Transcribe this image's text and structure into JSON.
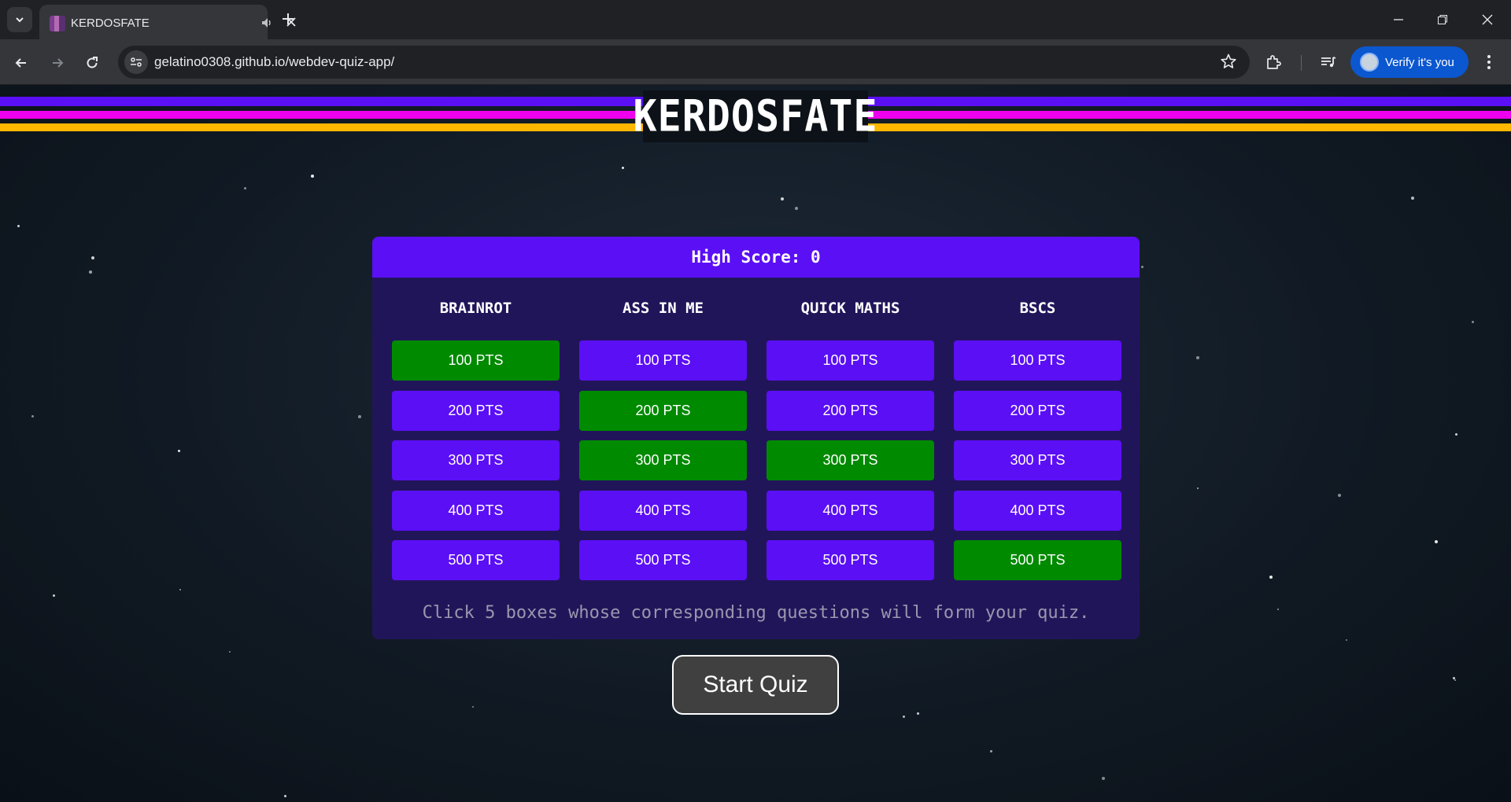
{
  "browser": {
    "tab_title": "KERDOSFATE",
    "url": "gelatino0308.github.io/webdev-quiz-app/",
    "profile_button": "Verify it's you",
    "icons": [
      "tab-search-icon",
      "audio-icon",
      "close-icon",
      "plus-icon",
      "minimize-icon",
      "restore-icon",
      "back-icon",
      "forward-icon",
      "reload-icon",
      "site-info-icon",
      "star-icon",
      "extensions-icon",
      "media-icon",
      "kebab-menu-icon"
    ]
  },
  "page": {
    "logo": "KERDOSFATE",
    "high_score_label": "High Score: 0",
    "colors": {
      "tile_default": "#5b0ff5",
      "tile_selected": "#008a00",
      "board_bg": "#21155a",
      "stripe_purple": "#5b0ff5",
      "stripe_magenta": "#ee00ee",
      "stripe_gold": "#ffb700"
    },
    "categories": [
      {
        "name": "BRAINROT",
        "tiles": [
          {
            "label": "100 PTS",
            "selected": true
          },
          {
            "label": "200 PTS",
            "selected": false
          },
          {
            "label": "300 PTS",
            "selected": false
          },
          {
            "label": "400 PTS",
            "selected": false
          },
          {
            "label": "500 PTS",
            "selected": false
          }
        ]
      },
      {
        "name": "ASS IN ME",
        "tiles": [
          {
            "label": "100 PTS",
            "selected": false
          },
          {
            "label": "200 PTS",
            "selected": true
          },
          {
            "label": "300 PTS",
            "selected": true
          },
          {
            "label": "400 PTS",
            "selected": false
          },
          {
            "label": "500 PTS",
            "selected": false
          }
        ]
      },
      {
        "name": "QUICK MATHS",
        "tiles": [
          {
            "label": "100 PTS",
            "selected": false
          },
          {
            "label": "200 PTS",
            "selected": false
          },
          {
            "label": "300 PTS",
            "selected": true
          },
          {
            "label": "400 PTS",
            "selected": false
          },
          {
            "label": "500 PTS",
            "selected": false
          }
        ]
      },
      {
        "name": "BSCS",
        "tiles": [
          {
            "label": "100 PTS",
            "selected": false
          },
          {
            "label": "200 PTS",
            "selected": false
          },
          {
            "label": "300 PTS",
            "selected": false
          },
          {
            "label": "400 PTS",
            "selected": false
          },
          {
            "label": "500 PTS",
            "selected": true
          }
        ]
      }
    ],
    "instruction": "Click 5 boxes whose corresponding questions will form your quiz.",
    "start_button": "Start Quiz"
  }
}
